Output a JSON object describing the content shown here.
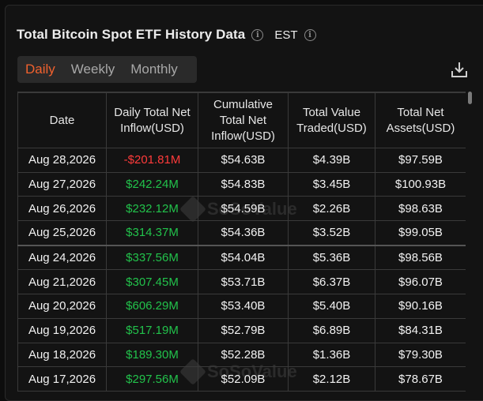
{
  "header": {
    "title": "Total Bitcoin Spot ETF History Data",
    "timezone": "EST"
  },
  "tabs": [
    {
      "label": "Daily",
      "active": true
    },
    {
      "label": "Weekly",
      "active": false
    },
    {
      "label": "Monthly",
      "active": false
    }
  ],
  "table": {
    "columns": [
      "Date",
      "Daily Total Net Inflow(USD)",
      "Cumulative Total Net Inflow(USD)",
      "Total Value Traded(USD)",
      "Total Net Assets(USD)"
    ],
    "rows": [
      {
        "date": "Aug 28,2026",
        "inflow": "-$201.81M",
        "cumulative": "$54.63B",
        "traded": "$4.39B",
        "assets": "$97.59B"
      },
      {
        "date": "Aug 27,2026",
        "inflow": "$242.24M",
        "cumulative": "$54.83B",
        "traded": "$3.45B",
        "assets": "$100.93B"
      },
      {
        "date": "Aug 26,2026",
        "inflow": "$232.12M",
        "cumulative": "$54.59B",
        "traded": "$2.26B",
        "assets": "$98.63B"
      },
      {
        "date": "Aug 25,2026",
        "inflow": "$314.37M",
        "cumulative": "$54.36B",
        "traded": "$3.52B",
        "assets": "$99.05B"
      },
      {
        "date": "Aug 24,2026",
        "inflow": "$337.56M",
        "cumulative": "$54.04B",
        "traded": "$5.36B",
        "assets": "$98.56B"
      },
      {
        "date": "Aug 21,2026",
        "inflow": "$307.45M",
        "cumulative": "$53.71B",
        "traded": "$6.37B",
        "assets": "$96.07B"
      },
      {
        "date": "Aug 20,2026",
        "inflow": "$606.29M",
        "cumulative": "$53.40B",
        "traded": "$5.40B",
        "assets": "$90.16B"
      },
      {
        "date": "Aug 19,2026",
        "inflow": "$517.19M",
        "cumulative": "$52.79B",
        "traded": "$6.89B",
        "assets": "$84.31B"
      },
      {
        "date": "Aug 18,2026",
        "inflow": "$189.30M",
        "cumulative": "$52.28B",
        "traded": "$1.36B",
        "assets": "$79.30B"
      },
      {
        "date": "Aug 17,2026",
        "inflow": "$297.56M",
        "cumulative": "$52.09B",
        "traded": "$2.12B",
        "assets": "$78.67B"
      }
    ]
  },
  "watermark": "SoSoValue",
  "colors": {
    "accent": "#f0612e",
    "positive": "#22c24b",
    "negative": "#ff3b3b"
  },
  "icons": {
    "info": "info-icon",
    "download": "download-icon"
  }
}
